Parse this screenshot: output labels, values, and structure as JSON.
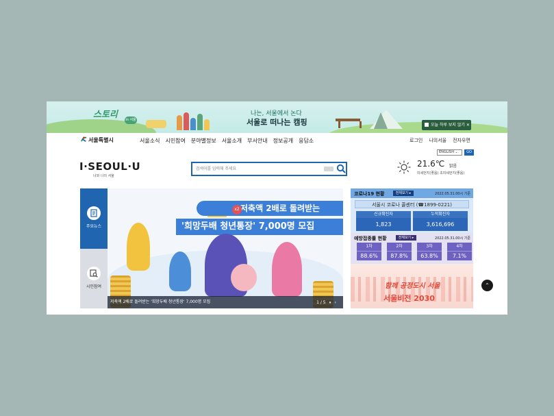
{
  "promo": {
    "story_logo": "스토리",
    "story_badge": "in 서울",
    "sub": "나는, 서울에서 논다",
    "main": "서울로 떠나는 캠핑",
    "close_label": "오늘 하루 보지 않기",
    "close_x": "✕"
  },
  "gnb": {
    "logo": "서울특별시",
    "menu": [
      "서울소식",
      "시민참여",
      "분야별정보",
      "서울소개",
      "부서안내",
      "정보공개",
      "응답소"
    ],
    "util": [
      "로그인",
      "나의서울",
      "전자우편"
    ],
    "lang_select": "ENGLISH",
    "lang_go": "GO"
  },
  "brand": {
    "title": "I·SEOUL·U",
    "tagline": "너와 나의 서울"
  },
  "search": {
    "placeholder": "검색어를 입력해 주세요"
  },
  "weather": {
    "temp": "21.6℃",
    "condition": "맑음",
    "dust": "미세먼지(좋음) 초미세먼지(좋음)"
  },
  "tabs": [
    {
      "label": "주요뉴스",
      "icon": "news-icon"
    },
    {
      "label": "시민참여",
      "icon": "search-doc-icon"
    }
  ],
  "hero": {
    "badge": "x2",
    "title1": "저축액 2배로 돌려받는",
    "title2": "'희망두배 청년통장' 7,000명 모집",
    "caption": "저축액 2배로 돌려받는 '희망두배 청년통장' 7,000명 모집",
    "pager": "1 / 5",
    "pause": "⏸",
    "next": "›"
  },
  "covid": {
    "title": "코로나19 현황",
    "more": "전체보기 ▸",
    "date": "2022.05.31.00시 기준",
    "center": "서울시 코로나 콜센터 (☎1899-0221)",
    "cells": [
      {
        "label": "신규확진자",
        "value": "1,823"
      },
      {
        "label": "누적확진자",
        "value": "3,616,696"
      }
    ]
  },
  "vax": {
    "title": "예방접종률 현황",
    "more": "전체보기 ▸",
    "date": "2022.05.31.00시 기준",
    "cells": [
      {
        "label": "1차",
        "value": "88.6%"
      },
      {
        "label": "2차",
        "value": "87.8%"
      },
      {
        "label": "3차",
        "value": "63.8%"
      },
      {
        "label": "4차",
        "value": "7.1%"
      }
    ]
  },
  "vision": {
    "script": "함께 공정도시 서울",
    "main": "서울비전 2030"
  },
  "totop": "⌃"
}
